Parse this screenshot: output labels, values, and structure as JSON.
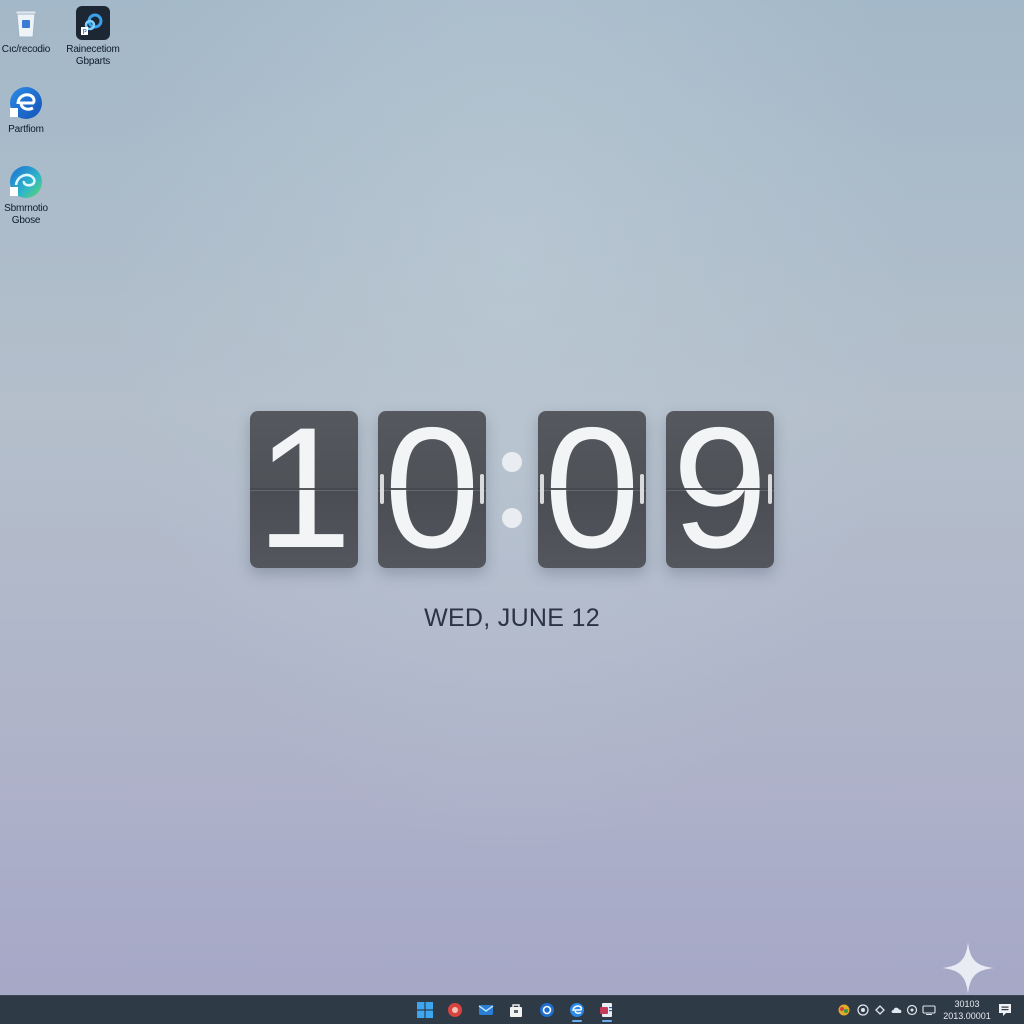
{
  "desktop_icons": [
    {
      "id": "recycle",
      "label": "Cıc/recodio",
      "icon": "recycle-bin-icon"
    },
    {
      "id": "app2",
      "label": "Rainecetiom\nGbparts",
      "icon": "settings-app-icon"
    },
    {
      "id": "edge1",
      "label": "Partfiom",
      "icon": "edge-browser-icon"
    },
    {
      "id": "edge2",
      "label": "Sbmrnotio\nGbose",
      "icon": "edge-browser-icon"
    }
  ],
  "clock": {
    "digits": [
      "1",
      "0",
      "0",
      "9"
    ],
    "time_text": "10:09",
    "date": "WED, JUNE 12"
  },
  "taskbar": {
    "apps": [
      {
        "name": "start",
        "icon": "windows-start-icon"
      },
      {
        "name": "app-red",
        "icon": "photos-icon"
      },
      {
        "name": "app-mail",
        "icon": "mail-icon"
      },
      {
        "name": "app-store",
        "icon": "store-bag-icon"
      },
      {
        "name": "app-settings",
        "icon": "settings-gear-icon"
      },
      {
        "name": "app-edge",
        "icon": "edge-browser-icon"
      },
      {
        "name": "app-word",
        "icon": "document-app-icon"
      }
    ],
    "tray_time": "30103",
    "tray_date": "2013.00001"
  },
  "colors": {
    "taskbar_bg": "#2f3a47",
    "flip_card": "#505459",
    "digit": "#f3f4f6",
    "date_text": "#2c3342",
    "accent": "#6ab0f0"
  }
}
